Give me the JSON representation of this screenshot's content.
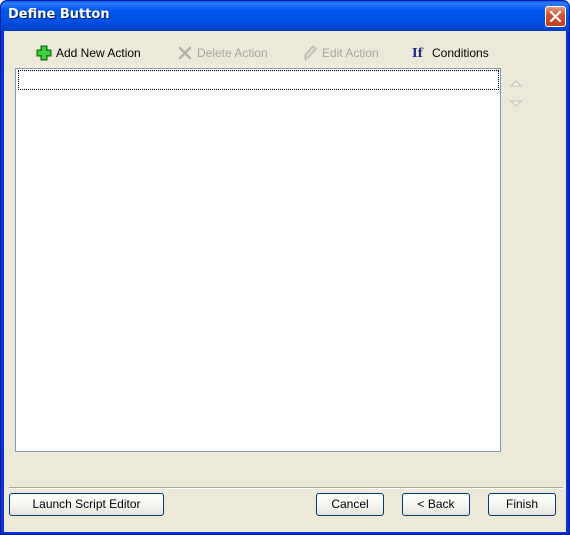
{
  "window": {
    "title": "Define Button"
  },
  "toolbar": {
    "add_action": {
      "label": "Add New Action",
      "icon": "green-plus-icon",
      "enabled": true
    },
    "delete_action": {
      "label": "Delete Action",
      "icon": "delete-x-icon",
      "enabled": false
    },
    "edit_action": {
      "label": "Edit Action",
      "icon": "pencil-icon",
      "enabled": false
    },
    "conditions": {
      "label": "Conditions",
      "glyph": "If",
      "enabled": true
    }
  },
  "actions_list": {
    "items": [
      ""
    ]
  },
  "move_buttons": {
    "up_icon": "arrow-up-icon",
    "down_icon": "arrow-down-icon",
    "enabled": false
  },
  "footer": {
    "launch_script_editor_label": "Launch Script Editor",
    "cancel_label": "Cancel",
    "back_label": "< Back",
    "finish_label": "Finish"
  },
  "colors": {
    "titlebar": "#0058ee",
    "client_background": "#ece9d8",
    "close_button": "#d4542d",
    "disabled_text": "#a9a79b",
    "list_border": "#7f9db9"
  }
}
